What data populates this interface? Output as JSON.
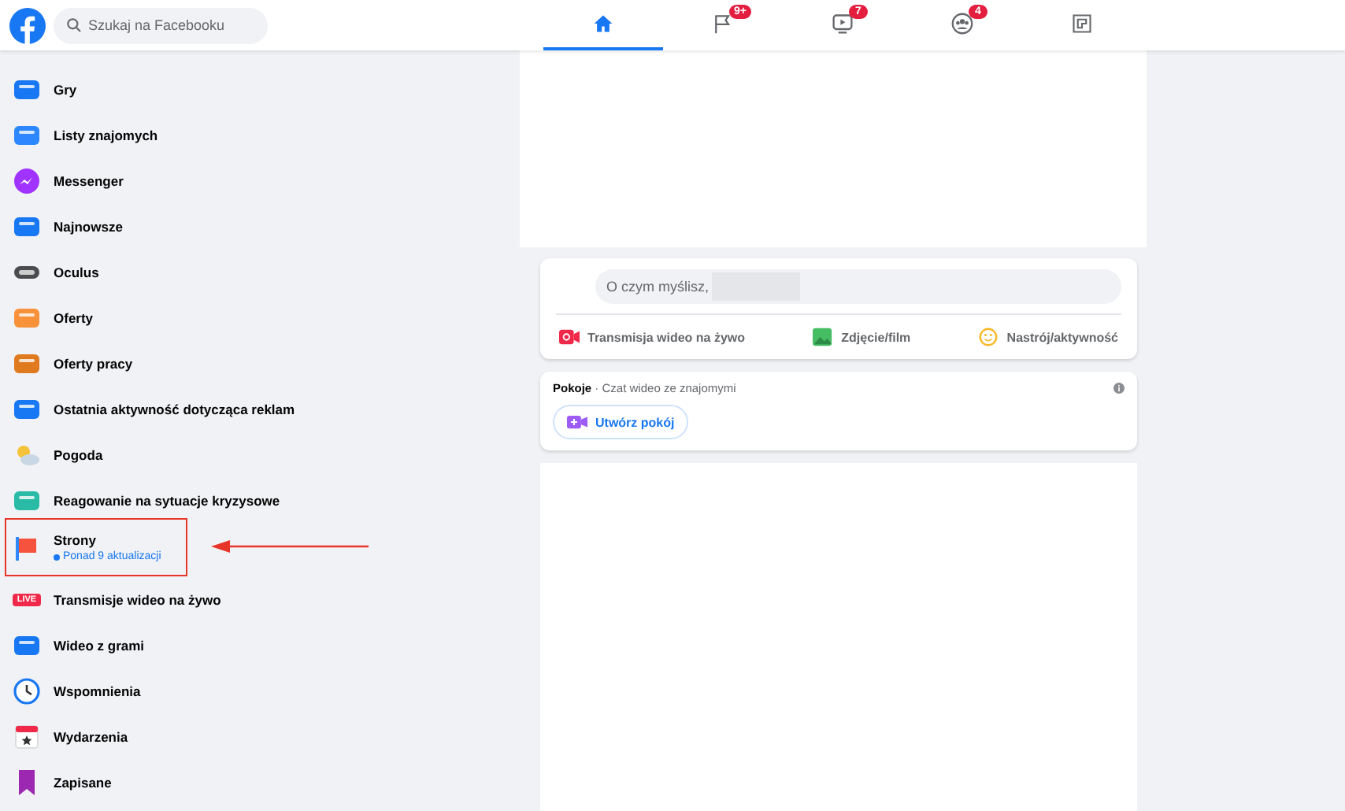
{
  "header": {
    "search": {
      "placeholder": "Szukaj na Facebooku"
    },
    "tabs": [
      {
        "kind": "home",
        "selected": true
      },
      {
        "kind": "flag",
        "selected": false,
        "badge": "9+"
      },
      {
        "kind": "video",
        "selected": false,
        "badge": "7"
      },
      {
        "kind": "groups",
        "selected": false,
        "badge": "4"
      },
      {
        "kind": "gaming",
        "selected": false
      }
    ]
  },
  "sidebar": {
    "items": [
      {
        "label": "Gry",
        "callout": false
      },
      {
        "label": "Listy znajomych",
        "callout": false
      },
      {
        "label": "Messenger",
        "callout": false
      },
      {
        "label": "Najnowsze",
        "callout": false
      },
      {
        "label": "Oculus",
        "callout": false
      },
      {
        "label": "Oferty",
        "callout": false
      },
      {
        "label": "Oferty pracy",
        "callout": false
      },
      {
        "label": "Ostatnia aktywność dotycząca reklam",
        "callout": false
      },
      {
        "label": "Pogoda",
        "callout": false
      },
      {
        "label": "Reagowanie na sytuacje kryzysowe",
        "callout": false
      },
      {
        "label": "Strony",
        "subtitle": "Ponad 9 aktualizacji",
        "callout": true
      },
      {
        "label": "Transmisje wideo na żywo",
        "icon_text": "LIVE",
        "callout": false
      },
      {
        "label": "Wideo z grami",
        "callout": false
      },
      {
        "label": "Wspomnienia",
        "callout": false
      },
      {
        "label": "Wydarzenia",
        "callout": false
      },
      {
        "label": "Zapisane",
        "callout": false
      }
    ]
  },
  "composer": {
    "placeholder": "O czym myślisz,",
    "actions": [
      "Transmisja wideo na żywo",
      "Zdjęcie/film",
      "Nastrój/aktywność"
    ]
  },
  "rooms": {
    "title": "Pokoje",
    "subtitle": "· Czat wideo ze znajomymi",
    "button": "Utwórz pokój"
  }
}
